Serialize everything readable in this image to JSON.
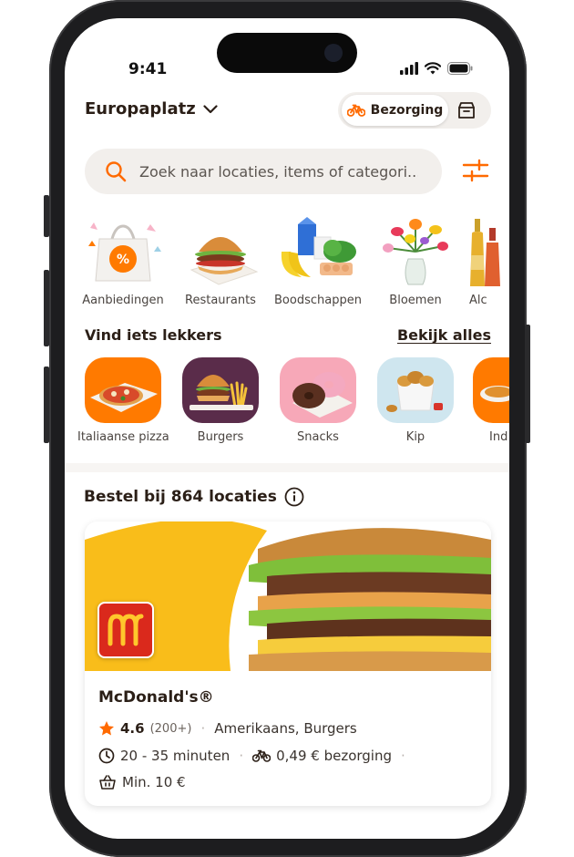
{
  "status_bar": {
    "time": "9:41"
  },
  "header": {
    "location": "Europaplatz",
    "delivery_mode": "Bezorging"
  },
  "search": {
    "placeholder": "Zoek naar locaties, items of categori..."
  },
  "categories": [
    {
      "label": "Aanbiedingen",
      "icon": "percent-bag-icon"
    },
    {
      "label": "Restaurants",
      "icon": "burger-icon"
    },
    {
      "label": "Boodschappen",
      "icon": "groceries-icon"
    },
    {
      "label": "Bloemen",
      "icon": "flowers-icon"
    },
    {
      "label": "Alc",
      "icon": "drinks-icon"
    }
  ],
  "discover": {
    "title": "Vind iets lekkers",
    "see_all": "Bekijk alles",
    "items": [
      {
        "label": "Italiaanse pizza",
        "bg": "#ff7a00"
      },
      {
        "label": "Burgers",
        "bg": "#5a2c4a"
      },
      {
        "label": "Snacks",
        "bg": "#f7a8b8"
      },
      {
        "label": "Kip",
        "bg": "#cfe6ef"
      },
      {
        "label": "Ind",
        "bg": "#ff7a00"
      }
    ]
  },
  "locations": {
    "title": "Bestel bij 864 locaties"
  },
  "restaurant": {
    "name": "McDonald's®",
    "rating": "4.6",
    "reviews": "(200+)",
    "cuisine": "Amerikaans, Burgers",
    "time": "20 - 35 minuten",
    "delivery_fee": "0,49 € bezorging",
    "min_order": "Min. 10 €"
  },
  "colors": {
    "accent": "#ff6a00",
    "brand_yellow": "#f9bd1a",
    "mcd_red": "#da291c"
  }
}
